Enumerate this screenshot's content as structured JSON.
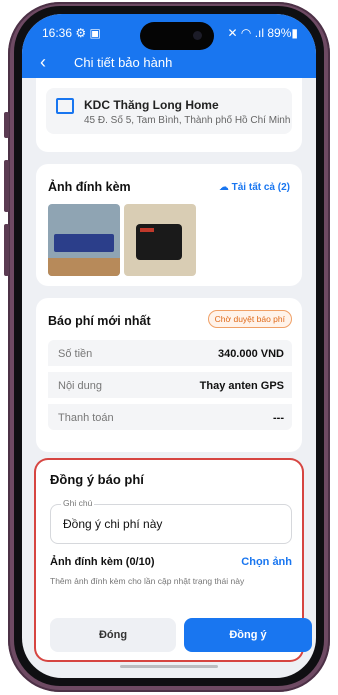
{
  "status": {
    "time": "16:36",
    "left_icons": "⚙ ▣",
    "right": "✕ ◠ .ıl 89%▮"
  },
  "header": {
    "title": "Chi tiết bảo hành"
  },
  "store": {
    "name": "KDC Thăng Long Home",
    "address": "45 Đ. Số 5, Tam Bình, Thành phố Hồ Chí Minh"
  },
  "attachments": {
    "title": "Ảnh đính kèm",
    "download_all": "Tải tất cả (2)"
  },
  "fee": {
    "title": "Báo phí mới nhất",
    "status_badge": "Chờ duyệt báo phí",
    "rows": [
      {
        "label": "Số tiền",
        "value": "340.000 VND"
      },
      {
        "label": "Nội dung",
        "value": "Thay anten GPS"
      },
      {
        "label": "Thanh toán",
        "value": "---"
      }
    ]
  },
  "sheet": {
    "title": "Đồng ý báo phí",
    "note_label": "Ghi chú",
    "note_value": "Đồng ý chi phí này",
    "attach_title": "Ảnh đính kèm (0/10)",
    "choose_image": "Chọn ảnh",
    "hint": "Thêm ảnh đính kèm cho lần cập nhật trạng thái này",
    "close_label": "Đóng",
    "agree_label": "Đồng ý"
  },
  "colors": {
    "accent": "#1976f0",
    "badge": "#e06a1a",
    "highlight_border": "#d64541"
  }
}
